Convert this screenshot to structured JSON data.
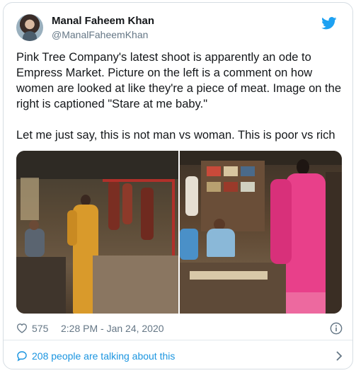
{
  "tweet": {
    "author_name": "Manal Faheem Khan",
    "author_handle": "@ManalFaheemKhan",
    "paragraphs": [
      "Pink Tree Company's latest shoot is apparently an ode to Empress Market. Picture on the left is a comment on how women are looked at like they're a piece of meat. Image on the right is captioned \"Stare at me baby.\"",
      "Let me just say, this is not man vs woman. This is poor vs rich"
    ],
    "likes": "575",
    "timestamp": "2:28 PM - Jan 24, 2020",
    "talking": "208 people are talking about this"
  },
  "icons": {
    "platform": "twitter-bird-icon",
    "like": "heart-icon",
    "info": "info-icon",
    "reply": "speech-bubble-icon",
    "next": "chevron-right-icon"
  },
  "colors": {
    "text": "#14171a",
    "secondary": "#657786",
    "accent": "#1b95e0",
    "twitter_blue": "#1da1f2",
    "border": "#d6dde3"
  }
}
